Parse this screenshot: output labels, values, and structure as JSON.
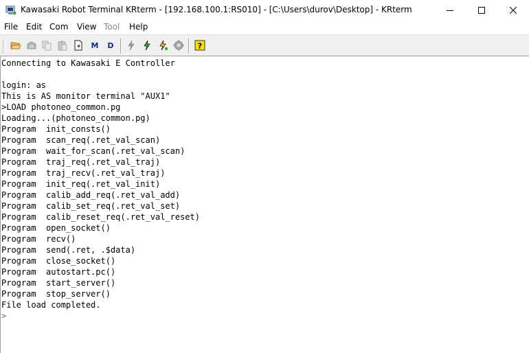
{
  "window": {
    "title": "Kawasaki Robot Terminal KRterm - [192.168.100.1:RS010] - [C:\\Users\\durov\\Desktop] - KRterm",
    "controls": [
      "minimize-icon",
      "maximize-icon",
      "close-icon"
    ]
  },
  "menu": {
    "items": [
      {
        "label": "File",
        "enabled": true
      },
      {
        "label": "Edit",
        "enabled": true
      },
      {
        "label": "Com",
        "enabled": true
      },
      {
        "label": "View",
        "enabled": true
      },
      {
        "label": "Tool",
        "enabled": false
      },
      {
        "label": "Help",
        "enabled": true
      }
    ]
  },
  "toolbar": {
    "buttons": [
      {
        "icon": "open-folder-icon",
        "enabled": true
      },
      {
        "icon": "save-icon",
        "enabled": false
      },
      {
        "icon": "copy-icon",
        "enabled": false
      },
      {
        "icon": "paste-icon",
        "enabled": false
      },
      {
        "icon": "log-file-icon",
        "enabled": true
      },
      {
        "icon": "m-letter-icon",
        "label": "M",
        "enabled": true
      },
      {
        "icon": "d-letter-icon",
        "label": "D",
        "enabled": true
      },
      {
        "icon": "disconnect-icon",
        "enabled": false
      },
      {
        "icon": "connect-icon",
        "enabled": true
      },
      {
        "icon": "reconnect-icon",
        "enabled": true
      },
      {
        "icon": "settings-gear-icon",
        "enabled": false
      },
      {
        "icon": "help-icon",
        "enabled": true
      }
    ],
    "colors": {
      "accent_green": "#2db82d",
      "accent_yellow": "#f5d800",
      "letter_blue": "#1a2a8a"
    }
  },
  "terminal": {
    "lines": [
      "Connecting to Kawasaki E Controller",
      "",
      "login: as",
      "This is AS monitor terminal \"AUX1\"",
      ">LOAD photoneo_common.pg",
      "Loading...(photoneo_common.pg)",
      "Program  init_consts()",
      "Program  scan_req(.ret_val_scan)",
      "Program  wait_for_scan(.ret_val_scan)",
      "Program  traj_req(.ret_val_traj)",
      "Program  traj_recv(.ret_val_traj)",
      "Program  init_req(.ret_val_init)",
      "Program  calib_add_req(.ret_val_add)",
      "Program  calib_set_req(.ret_val_set)",
      "Program  calib_reset_req(.ret_val_reset)",
      "Program  open_socket()",
      "Program  recv()",
      "Program  send(.ret, .$data)",
      "Program  close_socket()",
      "Program  autostart.pc()",
      "Program  start_server()",
      "Program  stop_server()",
      "File load completed.",
      ">"
    ]
  }
}
